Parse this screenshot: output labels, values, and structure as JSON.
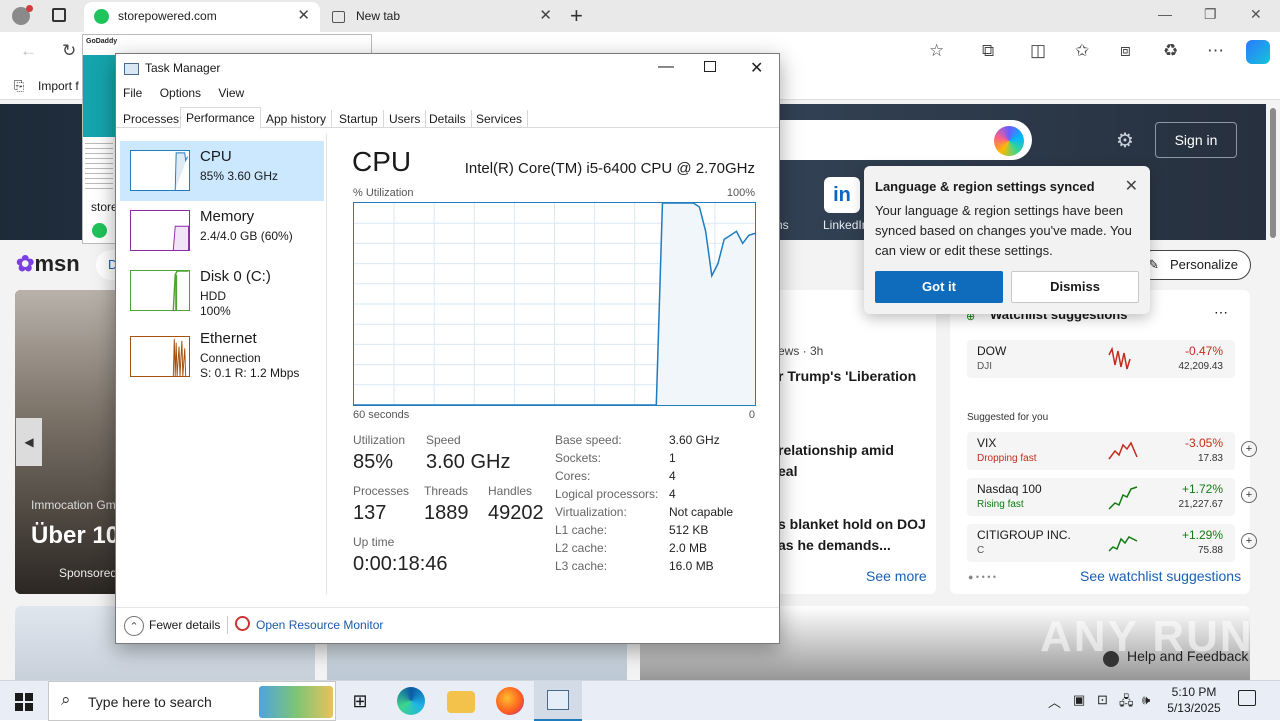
{
  "browser": {
    "tabs": [
      {
        "label": "storepowered.com",
        "active": true
      },
      {
        "label": "New tab",
        "active": false
      }
    ],
    "new_tab_icon": "plus-icon",
    "favorites_bar": {
      "import_label": "Import f"
    },
    "accent": "#0f6cbd"
  },
  "msn": {
    "sign_in": "Sign in",
    "logo_text": "msn",
    "nav_partial": "D",
    "personalize": "Personalize",
    "linkedin_label": "LinkedIn",
    "ns_partial": "ns",
    "hero": {
      "subtitle": "Immocation Gm",
      "title": "Über 10",
      "sponsored": "Sponsored"
    },
    "news": {
      "time_partial": "ews · 3h",
      "items": [
        "r Trump's 'Liberation",
        "relationship amid\neal",
        "s blanket hold on DOJ\nas he demands..."
      ],
      "see_more": "See more"
    },
    "watchlist": {
      "title": "Watchlist suggestions",
      "suggested_label": "Suggested for you",
      "see_more": "See watchlist suggestions",
      "stocks": [
        {
          "name": "DOW",
          "sub": "DJI",
          "change": "-0.47%",
          "price": "42,209.43",
          "trend": "down"
        },
        {
          "name": "VIX",
          "sub": "Dropping fast",
          "change": "-3.05%",
          "price": "17.83",
          "trend": "down"
        },
        {
          "name": "Nasdaq 100",
          "sub": "Rising fast",
          "change": "+1.72%",
          "price": "21,227.67",
          "trend": "up"
        },
        {
          "name": "CITIGROUP INC.",
          "sub": "C",
          "change": "+1.29%",
          "price": "75.88",
          "trend": "up"
        }
      ]
    },
    "help_feedback": "Help and Feedback",
    "watermark": "ANY RUN"
  },
  "toast": {
    "title": "Language & region settings synced",
    "body": "Your language & region settings have been synced based on changes you've made. You can view or edit these settings.",
    "primary": "Got it",
    "secondary": "Dismiss"
  },
  "background_doc": {
    "brand": "GoDaddy",
    "store_label": "store"
  },
  "task_manager": {
    "title": "Task Manager",
    "menu": [
      "File",
      "Options",
      "View"
    ],
    "tabs": [
      "Processes",
      "Performance",
      "App history",
      "Startup",
      "Users",
      "Details",
      "Services"
    ],
    "active_tab": "Performance",
    "sidebar": [
      {
        "name": "CPU",
        "line1": "85%  3.60 GHz",
        "line2": "",
        "color": "#1e7cbf"
      },
      {
        "name": "Memory",
        "line1": "2.4/4.0 GB (60%)",
        "line2": "",
        "color": "#8b2ba8"
      },
      {
        "name": "Disk 0 (C:)",
        "line1": "HDD",
        "line2": "100%",
        "color": "#4da32f"
      },
      {
        "name": "Ethernet",
        "line1": "Connection",
        "line2": "S: 0.1  R: 1.2 Mbps",
        "color": "#a74f0d"
      }
    ],
    "cpu": {
      "heading": "CPU",
      "model": "Intel(R) Core(TM) i5-6400 CPU @ 2.70GHz",
      "util_label": "% Utilization",
      "max_label": "100%",
      "time_left": "60 seconds",
      "time_right": "0",
      "graph_series": [
        0,
        0,
        0,
        0,
        0,
        0,
        0,
        0,
        0,
        0,
        0,
        0,
        0,
        0,
        0,
        0,
        0,
        0,
        0,
        0,
        0,
        0,
        0,
        0,
        0,
        0,
        0,
        0,
        0,
        0,
        0,
        0,
        0,
        0,
        0,
        0,
        0,
        0,
        0,
        0,
        0,
        0,
        0,
        0,
        0,
        0,
        0,
        0,
        0,
        0,
        100,
        100,
        100,
        100,
        100,
        100,
        98,
        86,
        64,
        70,
        82,
        84,
        86,
        80,
        84,
        85
      ],
      "stats": {
        "utilization_label": "Utilization",
        "utilization": "85%",
        "speed_label": "Speed",
        "speed": "3.60 GHz",
        "processes_label": "Processes",
        "processes": "137",
        "threads_label": "Threads",
        "threads": "1889",
        "handles_label": "Handles",
        "handles": "49202",
        "uptime_label": "Up time",
        "uptime": "0:00:18:46"
      },
      "specs": [
        {
          "k": "Base speed:",
          "v": "3.60 GHz"
        },
        {
          "k": "Sockets:",
          "v": "1"
        },
        {
          "k": "Cores:",
          "v": "4"
        },
        {
          "k": "Logical processors:",
          "v": "4"
        },
        {
          "k": "Virtualization:",
          "v": "Not capable"
        },
        {
          "k": "L1 cache:",
          "v": "512 KB"
        },
        {
          "k": "L2 cache:",
          "v": "2.0 MB"
        },
        {
          "k": "L3 cache:",
          "v": "16.0 MB"
        }
      ]
    },
    "footer": {
      "fewer": "Fewer details",
      "resmon": "Open Resource Monitor"
    }
  },
  "taskbar": {
    "search_placeholder": "Type here to search",
    "time": "5:10 PM",
    "date": "5/13/2025"
  }
}
